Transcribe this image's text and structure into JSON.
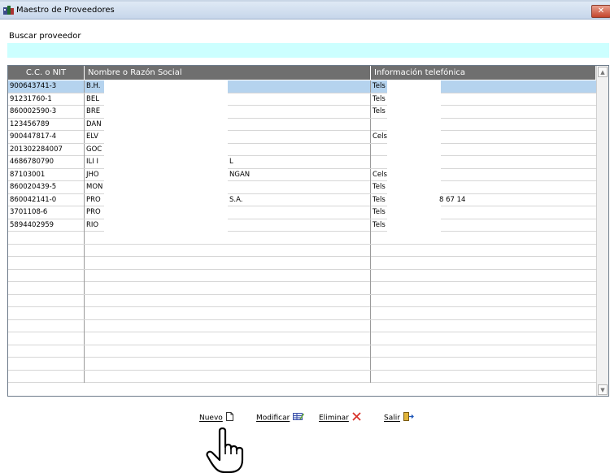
{
  "window": {
    "title": "Maestro de Proveedores",
    "close_glyph": "✕"
  },
  "search": {
    "label": "Buscar proveedor",
    "value": ""
  },
  "table": {
    "columns": [
      "C.C. o NIT",
      "Nombre o Razón Social",
      "Información telefónica"
    ],
    "rows": [
      {
        "nit": "900643741-3",
        "name": "B.H.",
        "name_tail": "",
        "phone": "Tels",
        "phone_tail": "",
        "selected": true
      },
      {
        "nit": "91231760-1",
        "name": "BEL",
        "name_tail": "",
        "phone": "Tels",
        "phone_tail": ""
      },
      {
        "nit": "860002590-3",
        "name": "BRE",
        "name_tail": "",
        "phone": "Tels",
        "phone_tail": ""
      },
      {
        "nit": "123456789",
        "name": "DAN",
        "name_tail": "",
        "phone": "",
        "phone_tail": ""
      },
      {
        "nit": "900447817-4",
        "name": "ELV",
        "name_tail": "",
        "phone": "Cels",
        "phone_tail": ""
      },
      {
        "nit": "201302284007",
        "name": "GOC",
        "name_tail": "",
        "phone": "",
        "phone_tail": ""
      },
      {
        "nit": "4686780790",
        "name": "ILI I",
        "name_tail": "L",
        "phone": "",
        "phone_tail": ""
      },
      {
        "nit": "87103001",
        "name": "JHO",
        "name_tail": "NGAN",
        "phone": "Cels",
        "phone_tail": ""
      },
      {
        "nit": "860020439-5",
        "name": "MON",
        "name_tail": "",
        "phone": "Tels",
        "phone_tail": ""
      },
      {
        "nit": "860042141-0",
        "name": "PRO",
        "name_tail": "S.A.",
        "phone": "Tels",
        "phone_tail": "8 67 14"
      },
      {
        "nit": "3701108-6",
        "name": "PRO",
        "name_tail": "",
        "phone": "Tels",
        "phone_tail": ""
      },
      {
        "nit": "5894402959",
        "name": "RIO",
        "name_tail": "",
        "phone": "Tels",
        "phone_tail": ""
      }
    ],
    "empty_rows": 12
  },
  "buttons": {
    "new": "Nuevo",
    "modify": "Modificar",
    "delete": "Eliminar",
    "exit": "Salir"
  },
  "colors": {
    "header_bg": "#6f6f6f",
    "search_bg": "#ccffff",
    "selected_row": "#b5d3ee",
    "delete_red": "#d9332a"
  }
}
